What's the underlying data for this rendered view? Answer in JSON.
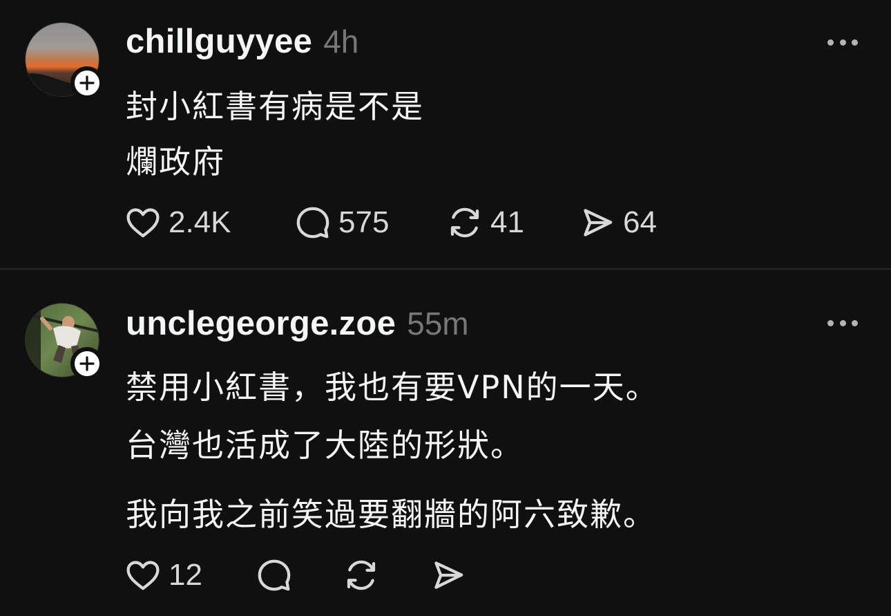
{
  "posts": [
    {
      "username": "chillguyyee",
      "time": "4h",
      "lines": [
        "封小紅書有病是不是",
        "爛政府"
      ],
      "likes": "2.4K",
      "replies": "575",
      "reposts": "41",
      "shares": "64"
    },
    {
      "username": "unclegeorge.zoe",
      "time": "55m",
      "lines": [
        "禁用小紅書，我也有要VPN的一天。",
        "台灣也活成了大陸的形狀。",
        "我向我之前笑過要翻牆的阿六致歉。"
      ],
      "likes": "12",
      "replies": "",
      "reposts": "",
      "shares": ""
    }
  ],
  "icons": {
    "like": "heart-icon",
    "reply": "comment-icon",
    "repost": "repost-icon",
    "share": "send-icon",
    "more": "more-options-icon",
    "follow": "plus-icon"
  },
  "colors": {
    "background": "#101010",
    "text": "#f3f5f7",
    "muted": "#777777",
    "divider": "#2a2a2a"
  }
}
